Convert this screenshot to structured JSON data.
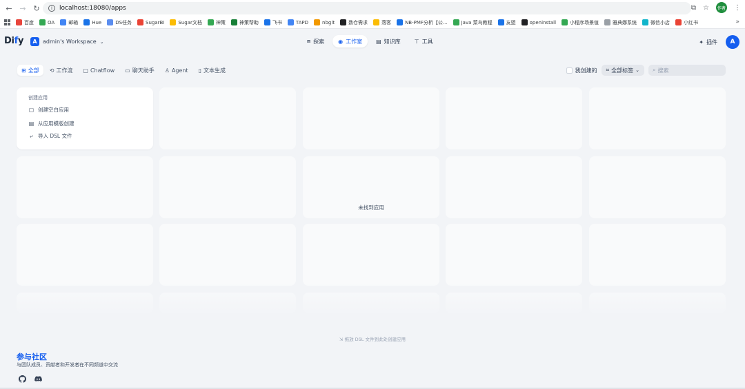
{
  "browser": {
    "url": "localhost:18080/apps",
    "profile_label": "作者",
    "bookmarks": [
      "百度",
      "OA",
      "邮箱",
      "Hue",
      "DS任务",
      "SugarBI",
      "Sugar文档",
      "神策",
      "神策帮助",
      "飞书",
      "TAPD",
      "nbgit",
      "数仓需求",
      "落客",
      "NB-PMF分析【公...",
      "Java 菜鸟教程",
      "友盟",
      "openinstall",
      "小程序场景值",
      "雅典娜系统",
      "微信小店",
      "小红书"
    ],
    "bookmark_colors": [
      "#e8453c",
      "#34a853",
      "#4285f4",
      "#1a73e8",
      "#5b8def",
      "#ea4335",
      "#fbbc05",
      "#34a853",
      "#188038",
      "#1a73e8",
      "#4285f4",
      "#f29900",
      "#202124",
      "#fbbc05",
      "#1a73e8",
      "#34a853",
      "#1a73e8",
      "#202124",
      "#34a853",
      "#9aa0a6",
      "#12b5cb",
      "#ea4335"
    ]
  },
  "app": {
    "logo": "Dify",
    "workspace_avatar": "A",
    "workspace_name": "admin's Workspace",
    "nav": [
      {
        "label": "探索",
        "icon": "compass-icon"
      },
      {
        "label": "工作室",
        "icon": "robot-icon",
        "active": true
      },
      {
        "label": "知识库",
        "icon": "book-icon"
      },
      {
        "label": "工具",
        "icon": "tool-icon"
      }
    ],
    "plugins_label": "插件",
    "user_avatar": "A"
  },
  "filters": {
    "tabs": [
      {
        "label": "全部",
        "icon": "grid-icon",
        "active": true
      },
      {
        "label": "工作流",
        "icon": "workflow-icon"
      },
      {
        "label": "Chatflow",
        "icon": "chatflow-icon"
      },
      {
        "label": "聊天助手",
        "icon": "chat-icon"
      },
      {
        "label": "Agent",
        "icon": "agent-icon"
      },
      {
        "label": "文本生成",
        "icon": "text-icon"
      }
    ],
    "mine_label": "我创建的",
    "tags_label": "全部标签",
    "search_placeholder": "搜索"
  },
  "create_card": {
    "title": "创建应用",
    "items": [
      {
        "label": "创建空白应用",
        "icon": "file-icon"
      },
      {
        "label": "从应用模版创建",
        "icon": "template-icon"
      },
      {
        "label": "导入 DSL 文件",
        "icon": "import-icon"
      }
    ]
  },
  "empty_text": "未找到应用",
  "dnd_hint": "拖放 DSL 文件到此处创建应用",
  "community": {
    "title": "参与社区",
    "desc": "与团队成员、贡献者和开发者在不同频道中交流",
    "links": [
      "github-icon",
      "discord-icon"
    ]
  },
  "colors": {
    "accent": "#155eef",
    "background": "#f2f4f7"
  }
}
